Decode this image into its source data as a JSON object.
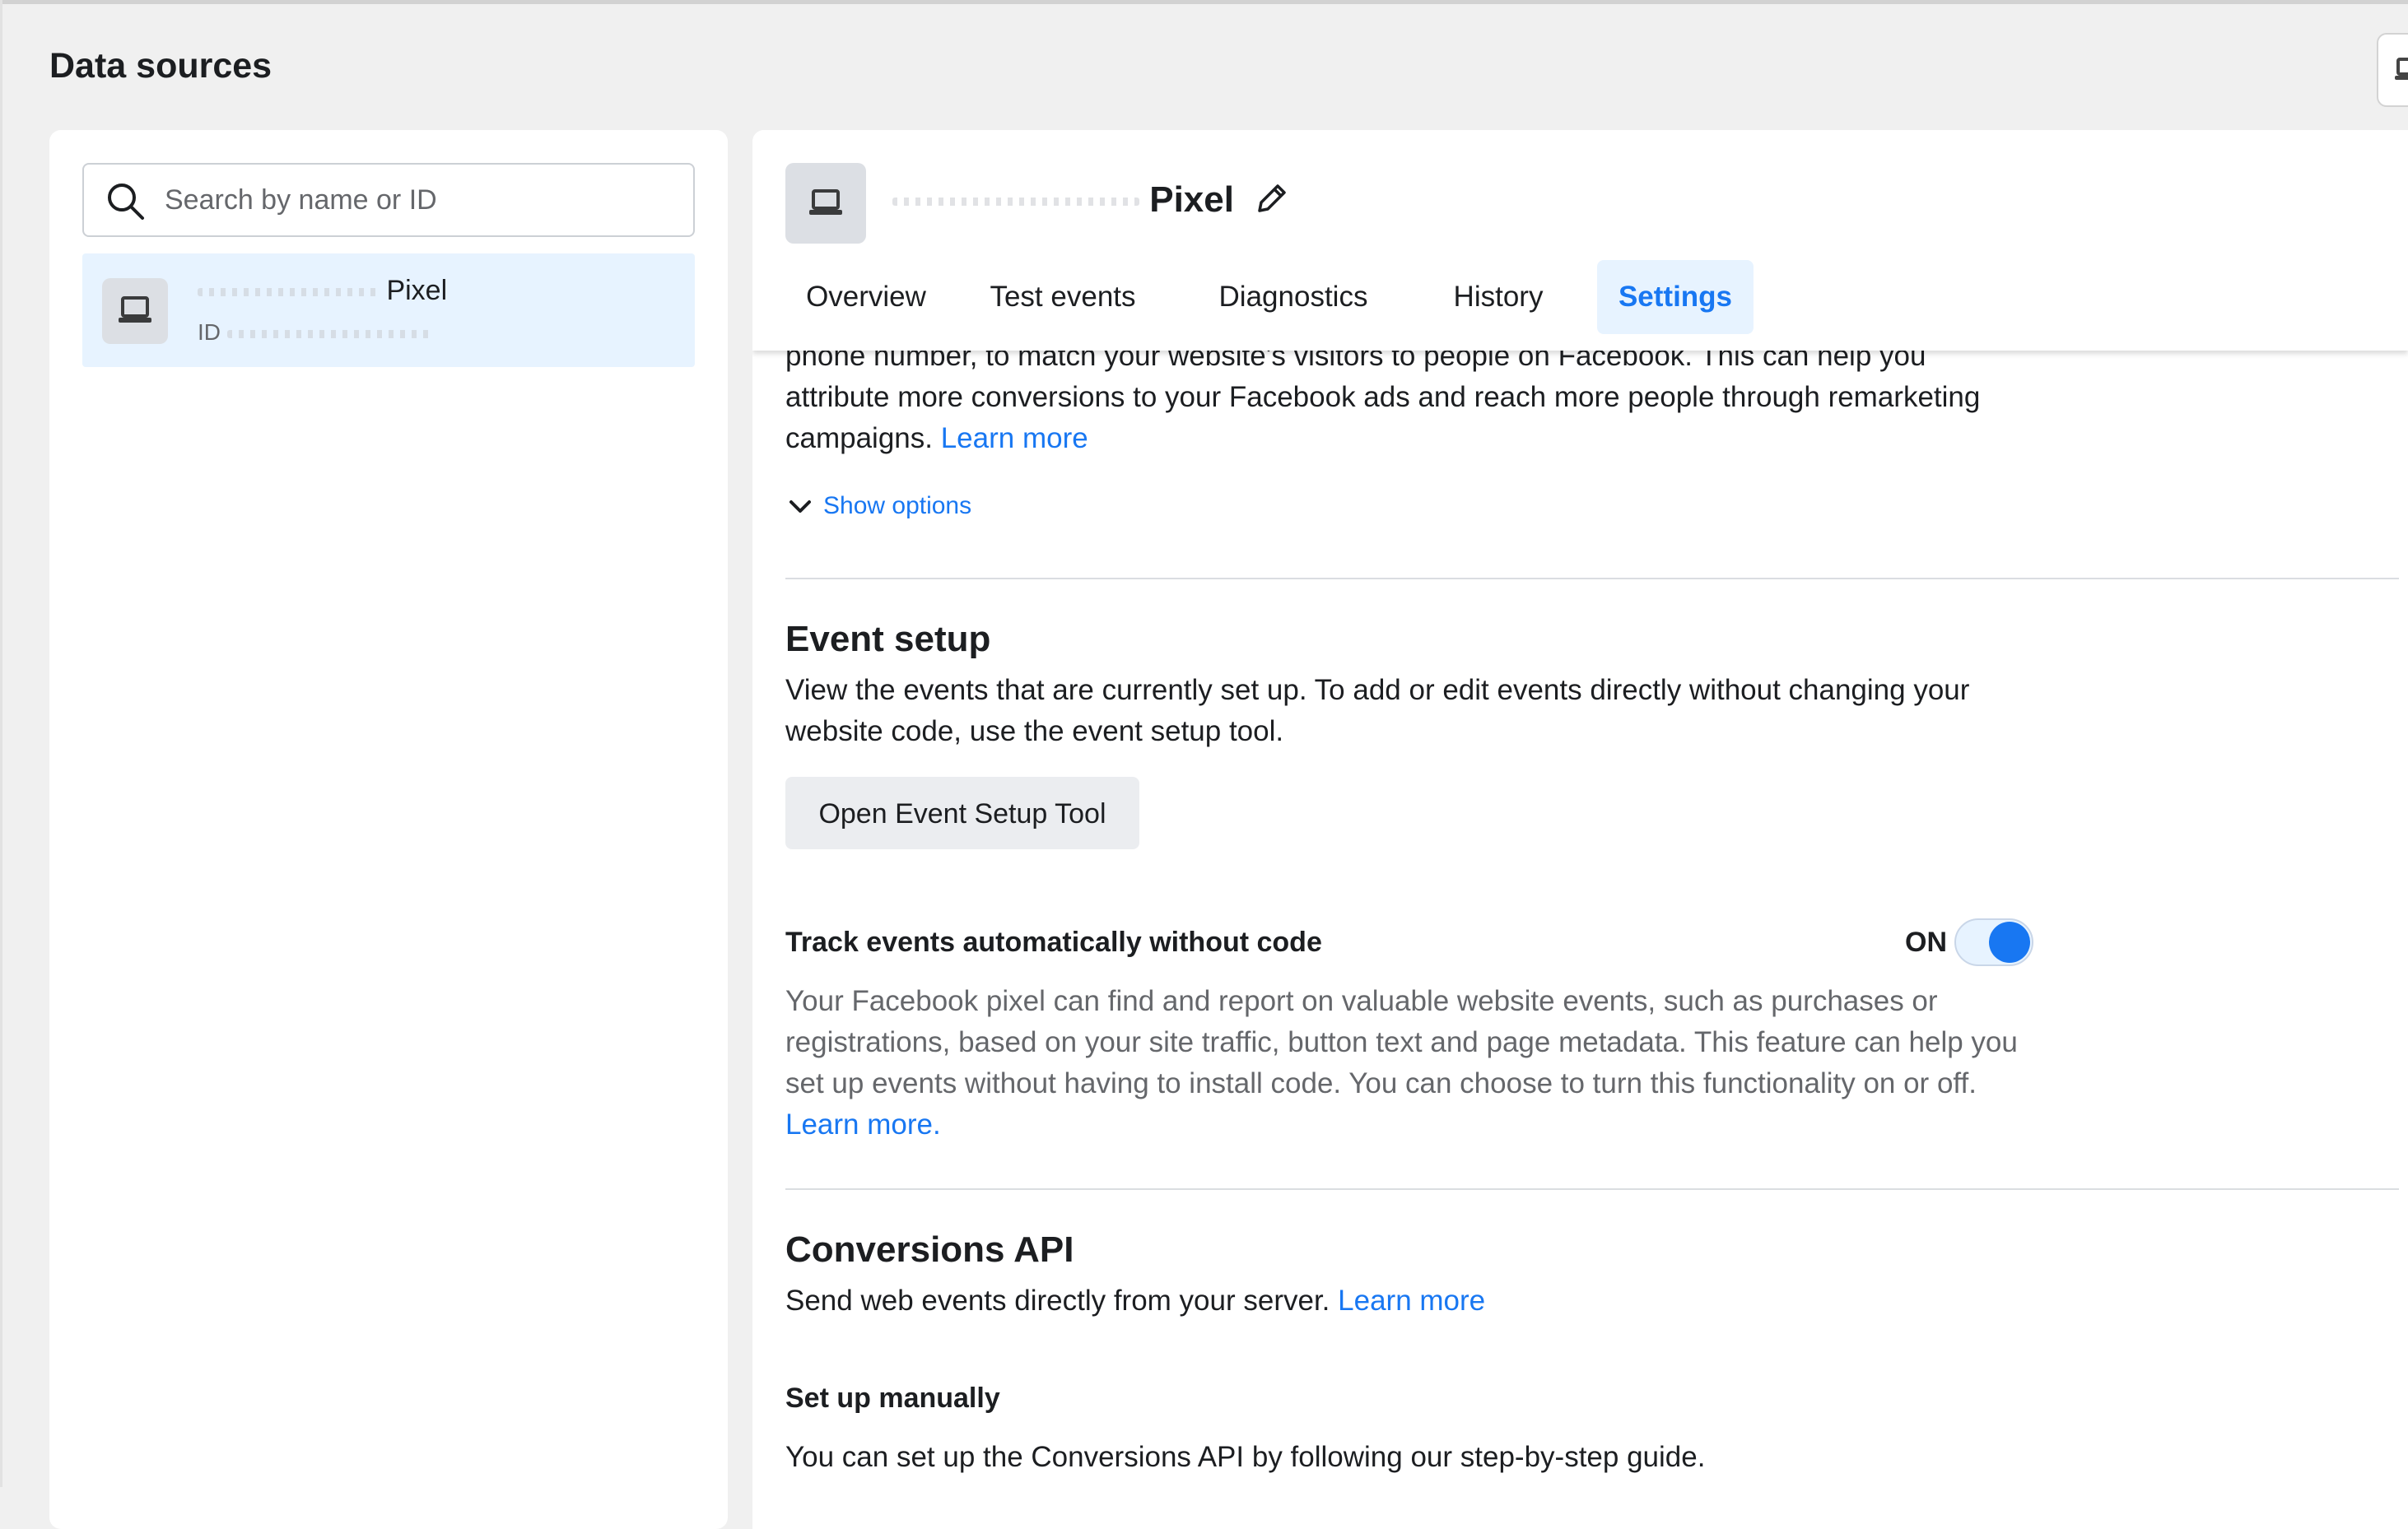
{
  "page": {
    "title": "Data sources"
  },
  "search": {
    "placeholder": "Search by name or ID"
  },
  "source_list": [
    {
      "name_suffix": "Pixel",
      "id_label": "ID"
    }
  ],
  "pixel_header": {
    "name_suffix": "Pixel"
  },
  "tabs": [
    {
      "label": "Overview",
      "active": false
    },
    {
      "label": "Test events",
      "active": false
    },
    {
      "label": "Diagnostics",
      "active": false
    },
    {
      "label": "History",
      "active": false
    },
    {
      "label": "Settings",
      "active": true
    }
  ],
  "advanced_matching": {
    "line1": "phone number, to match your website's visitors to people on Facebook. This can help you",
    "line2": "attribute more conversions to your Facebook ads and reach more people through remarketing",
    "line3": "campaigns.",
    "learn_more": "Learn more",
    "show_options": "Show options"
  },
  "event_setup": {
    "title": "Event setup",
    "description": "View the events that are currently set up. To add or edit events directly without changing your website code, use the event setup tool.",
    "button_label": "Open Event Setup Tool"
  },
  "auto_tracking": {
    "title": "Track events automatically without code",
    "toggle_state": "ON",
    "description": "Your Facebook pixel can find and report on valuable website events, such as purchases or registrations, based on your site traffic, button text and page metadata. This feature can help you set up events without having to install code. You can choose to turn this functionality on or off.",
    "learn_more": "Learn more."
  },
  "conversions_api": {
    "title": "Conversions API",
    "description": "Send web events directly from your server.",
    "learn_more": "Learn more",
    "manual_title": "Set up manually",
    "manual_description": "You can set up the Conversions API by following our step-by-step guide."
  },
  "colors": {
    "accent": "#1877f2",
    "selected_bg": "#e7f3ff",
    "page_bg": "#f0f0f0",
    "muted_text": "#65676b"
  },
  "icons": [
    "search-icon",
    "laptop-icon",
    "pencil-icon",
    "chevron-down-icon"
  ]
}
